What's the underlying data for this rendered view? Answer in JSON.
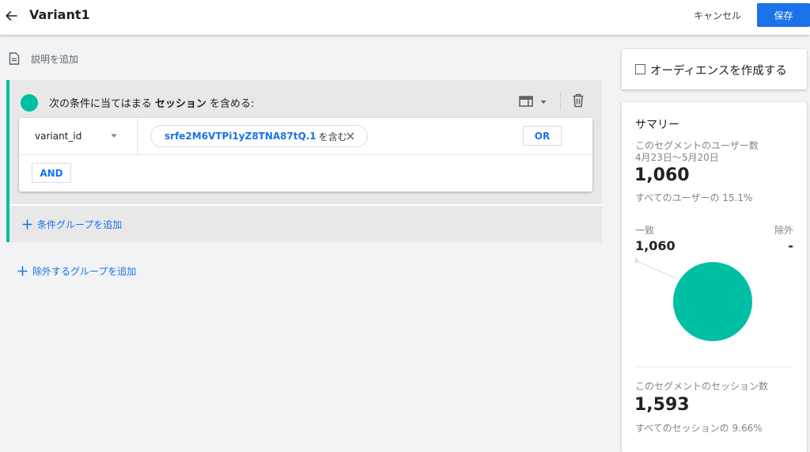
{
  "header": {
    "title": "Variant1",
    "cancel_label": "キャンセル",
    "save_label": "保存"
  },
  "description": {
    "label": "説明を追加"
  },
  "group": {
    "label_prefix": "次の条件に当てはまる",
    "label_bold": "セッション",
    "label_suffix": "を含める:",
    "accent_color": "#00bfa5",
    "condition": {
      "dimension": "variant_id",
      "value": "srfe2M6VTPi1yZ8TNA87tQ.1",
      "operator": "を含む",
      "or_label": "OR"
    },
    "and_label": "AND",
    "add_group_label": "条件グループを追加"
  },
  "add_exclude_label": "除外するグループを追加",
  "audience": {
    "label": "オーディエンスを作成する"
  },
  "summary": {
    "title": "サマリー",
    "users_label": "このセグメントのユーザー数",
    "date_range": "4月23日～5月20日",
    "users_value": "1,060",
    "users_pct": "すべてのユーザーの 15.1%",
    "match_label": "一致",
    "exclude_label": "除外",
    "match_value": "1,060",
    "exclude_value": "-",
    "sessions_label": "このセグメントのセッション数",
    "sessions_value": "1,593",
    "sessions_pct": "すべてのセッションの 9.66%"
  },
  "colors": {
    "primary": "#1a73e8",
    "accent": "#00bfa5"
  },
  "icons": [
    "back-arrow-icon",
    "document-icon",
    "table-view-icon",
    "chevron-down-icon",
    "trash-icon",
    "close-icon",
    "plus-icon",
    "checkbox-icon"
  ]
}
